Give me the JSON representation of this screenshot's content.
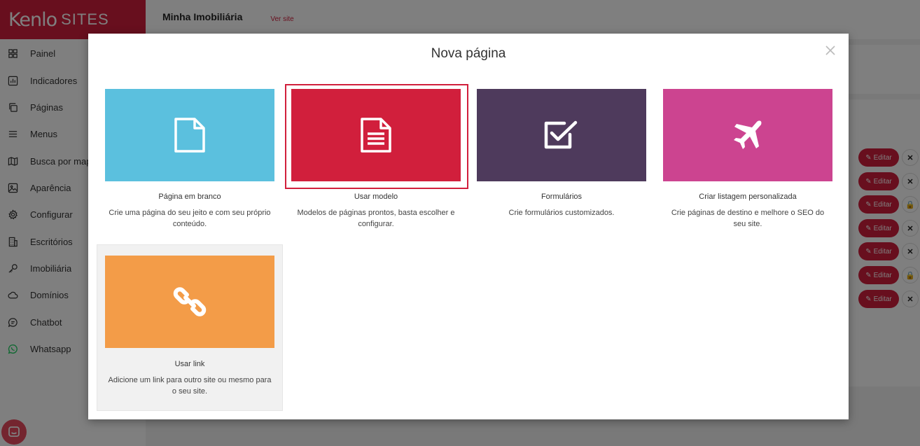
{
  "brand": {
    "logo_main": "Kenlo",
    "logo_sub": "SITES",
    "color": "#d11f3c"
  },
  "topbar": {
    "title": "Minha Imobiliária",
    "link": "Ver site"
  },
  "sidebar": {
    "items": [
      {
        "label": "Painel",
        "icon": "grid-icon"
      },
      {
        "label": "Indicadores",
        "icon": "bar-chart-icon"
      },
      {
        "label": "Páginas",
        "icon": "pages-icon"
      },
      {
        "label": "Menus",
        "icon": "menu-icon"
      },
      {
        "label": "Busca por mapa",
        "icon": "map-icon"
      },
      {
        "label": "Aparência",
        "icon": "image-icon"
      },
      {
        "label": "Configurar",
        "icon": "gear-icon"
      },
      {
        "label": "Escritórios",
        "icon": "building-icon"
      },
      {
        "label": "Imobiliária",
        "icon": "key-icon"
      },
      {
        "label": "Domínios",
        "icon": "cloud-icon"
      },
      {
        "label": "Chatbot",
        "icon": "chat-icon"
      },
      {
        "label": "Whatsapp",
        "icon": "whatsapp-icon"
      }
    ]
  },
  "table": {
    "edit_label": "Editar",
    "rows": [
      {
        "action": "delete"
      },
      {
        "action": "delete"
      },
      {
        "action": "lock"
      },
      {
        "action": "delete"
      },
      {
        "action": "delete"
      },
      {
        "action": "lock"
      },
      {
        "action": "delete"
      }
    ]
  },
  "modal": {
    "title": "Nova página",
    "options": [
      {
        "name": "Página em branco",
        "description": "Crie uma página do seu jeito e com seu próprio conteúdo.",
        "color": "#5bc0de",
        "icon": "blank-page-icon"
      },
      {
        "name": "Usar modelo",
        "description": "Modelos de páginas prontos, basta escolher e configurar.",
        "color": "#d11f3c",
        "icon": "template-page-icon"
      },
      {
        "name": "Formulários",
        "description": "Crie formulários customizados.",
        "color": "#4e3a5c",
        "icon": "checkbox-icon"
      },
      {
        "name": "Criar listagem personalizada",
        "description": "Crie páginas de destino e melhore o SEO do seu site.",
        "color": "#cc4490",
        "icon": "airplane-icon"
      },
      {
        "name": "Usar link",
        "description": "Adicione um link para outro site ou mesmo para o seu site.",
        "color": "#f39c48",
        "icon": "link-icon"
      }
    ]
  }
}
